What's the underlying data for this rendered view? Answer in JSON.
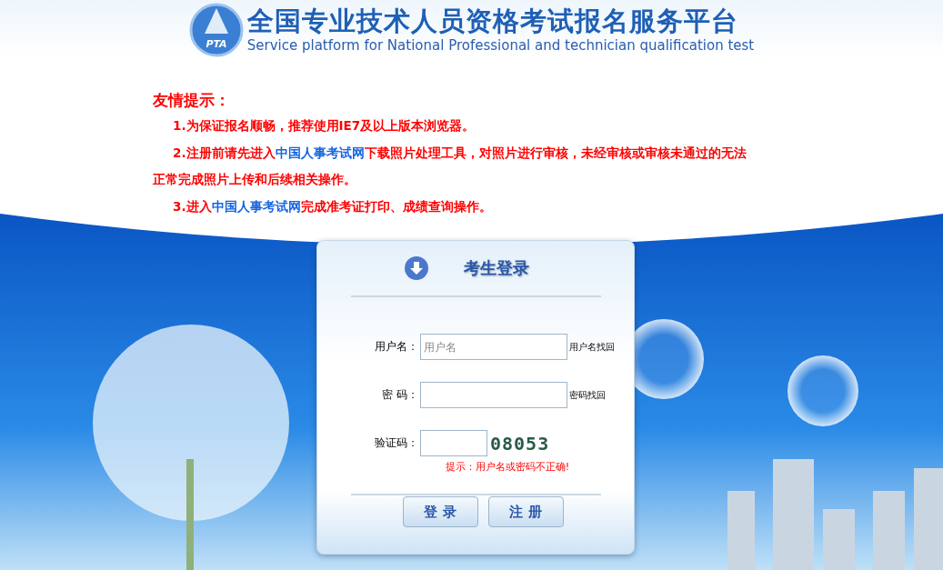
{
  "header": {
    "title": "全国专业技术人员资格考试报名服务平台",
    "subtitle": "Service platform for National Professional and technician qualification test",
    "logo_text": "PTA"
  },
  "notice": {
    "heading": "友情提示",
    "colon": "：",
    "items": [
      {
        "parts": [
          {
            "text": "1.为保证报名顺畅，推荐使用IE7及以上版本浏览器。",
            "link": false
          }
        ]
      },
      {
        "parts": [
          {
            "text": "2.注册前请先进入",
            "link": false
          },
          {
            "text": "中国人事考试网",
            "link": true
          },
          {
            "text": "下载照片处理工具，对照片进行审核，未经审核或审核未通过的无法",
            "link": false
          },
          {
            "text": "正常完成照片上传和后续相关操作。",
            "link": false
          }
        ]
      },
      {
        "parts": [
          {
            "text": "3.进入",
            "link": false
          },
          {
            "text": "中国人事考试网",
            "link": true
          },
          {
            "text": "完成准考证打印、成绩查询操作。",
            "link": false
          }
        ]
      }
    ]
  },
  "login": {
    "title": "考生登录",
    "fields": [
      {
        "label": "用户名：",
        "placeholder": "用户名",
        "kind": "text",
        "link": "用户名找回"
      },
      {
        "label": "密 码：",
        "kind": "password",
        "link": "密码找回"
      },
      {
        "label": "验证码：",
        "kind": "captcha",
        "captcha": "08053"
      }
    ],
    "error": "提示：用户名或密码不正确!",
    "buttons": [
      "登 录",
      "注 册"
    ]
  }
}
